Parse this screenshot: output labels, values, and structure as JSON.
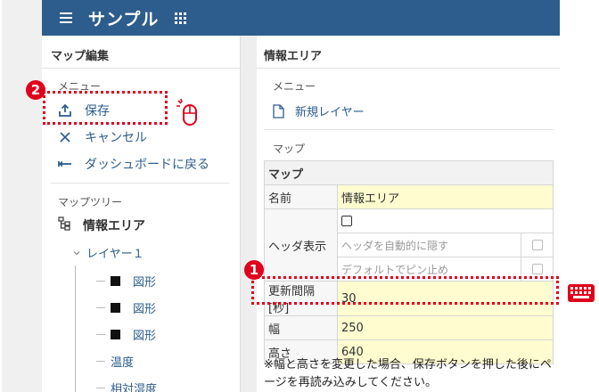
{
  "header": {
    "title": "サンプル"
  },
  "sidebar": {
    "title": "マップ編集",
    "menu_section": "メニュー",
    "menu": [
      {
        "label": "保存",
        "icon": "upload-icon"
      },
      {
        "label": "キャンセル",
        "icon": "close-icon"
      },
      {
        "label": "ダッシュボードに戻る",
        "icon": "back-arrow-icon"
      }
    ],
    "tree_section": "マップツリー",
    "tree_root": "情報エリア",
    "layer": "レイヤー１",
    "layer_items": [
      "図形",
      "図形",
      "図形",
      "温度",
      "相対湿度"
    ]
  },
  "main": {
    "title": "情報エリア",
    "menu_section": "メニュー",
    "new_layer": "新規レイヤー",
    "map_section": "マップ",
    "table": {
      "header": "マップ",
      "name_label": "名前",
      "name_value": "情報エリア",
      "header_display_label": "ヘッダ表示",
      "auto_hide_label": "ヘッダを自動的に隠す",
      "pin_label": "デフォルトでピン止め",
      "refresh_label": "更新間隔[秒]",
      "refresh_value": "30",
      "width_label": "幅",
      "width_value": "250",
      "height_label": "高さ",
      "height_value": "640"
    },
    "note": "※幅と高さを変更した場合、保存ボタンを押した後にページを再読み込みしてください。"
  },
  "badges": {
    "one": "1",
    "two": "2"
  },
  "colors": {
    "header": "#2d5d8c",
    "highlight": "#e0001b",
    "input_bg": "#fffccf"
  }
}
